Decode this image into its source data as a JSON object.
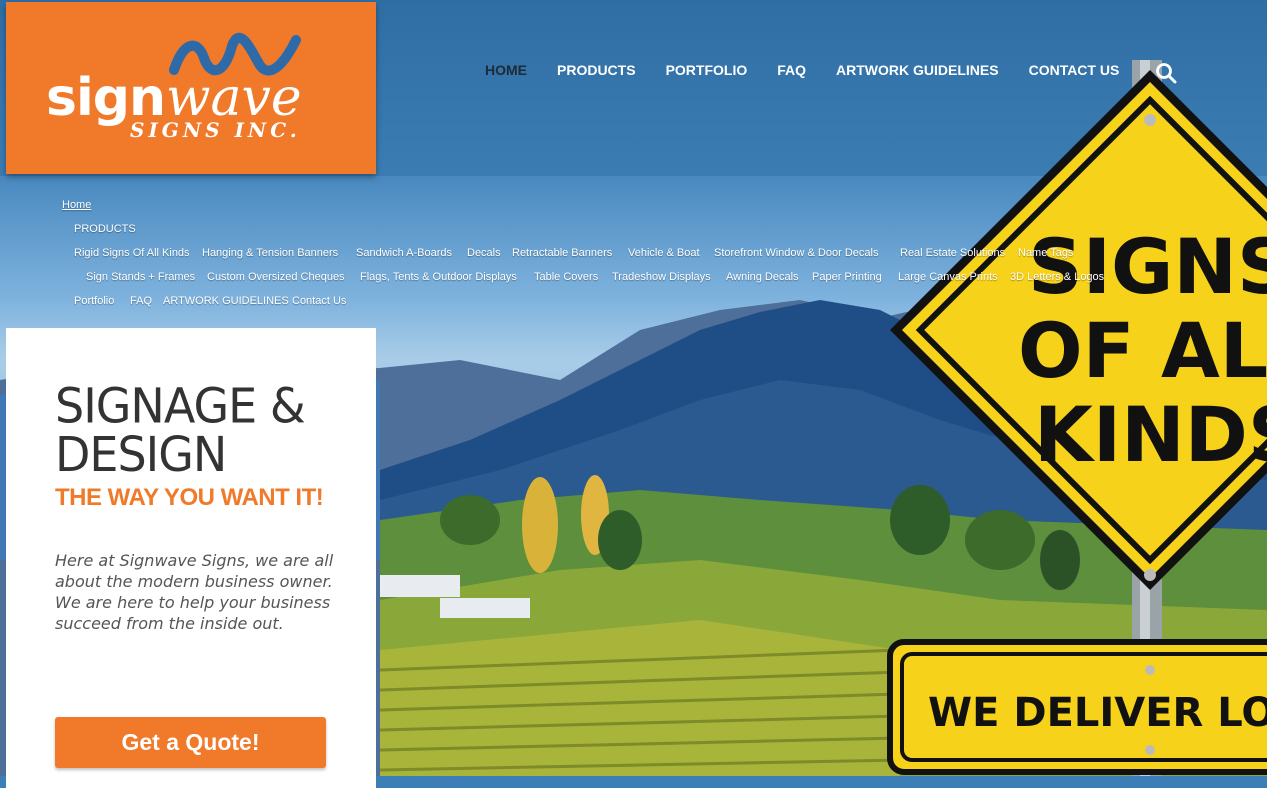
{
  "logo": {
    "sign": "sign",
    "wave": "wave",
    "sub": "SIGNS INC."
  },
  "nav": {
    "items": [
      {
        "label": "HOME",
        "active": true
      },
      {
        "label": "PRODUCTS"
      },
      {
        "label": "PORTFOLIO"
      },
      {
        "label": "FAQ"
      },
      {
        "label": "ARTWORK GUIDELINES"
      },
      {
        "label": "CONTACT US"
      }
    ]
  },
  "sitemap": {
    "home": "Home",
    "products": "PRODUCTS",
    "row1": [
      "Rigid Signs Of All Kinds",
      "Hanging & Tension Banners",
      "Sandwich A-Boards",
      "Decals",
      "Retractable Banners",
      "Vehicle & Boat",
      "Storefront Window & Door Decals",
      "Real Estate Solutions",
      "Name Tags"
    ],
    "row2": [
      "Sign Stands + Frames",
      "Custom Oversized Cheques",
      "Flags, Tents & Outdoor Displays",
      "Table Covers",
      "Tradeshow Displays",
      "Awning Decals",
      "Paper Printing",
      "Large Canvas Prints",
      "3D Letters & Logos"
    ],
    "row3": [
      "Portfolio",
      "FAQ",
      "ARTWORK GUIDELINES",
      "Contact Us"
    ]
  },
  "road_sign": {
    "line1": "SIGNS",
    "line2": "OF ALL",
    "line3": "KINDS",
    "bottom": "WE DELIVER LOC"
  },
  "hero": {
    "title_line1": "SIGNAGE &",
    "title_line2": "DESIGN",
    "tagline": "THE WAY YOU WANT IT!",
    "body": "Here at Signwave Signs, we are all about the modern business owner. We are here to help your business succeed from the inside out.",
    "cta_label": "Get a Quote!"
  },
  "colors": {
    "brand_orange": "#f07a2a",
    "sign_yellow": "#f7d21a"
  }
}
